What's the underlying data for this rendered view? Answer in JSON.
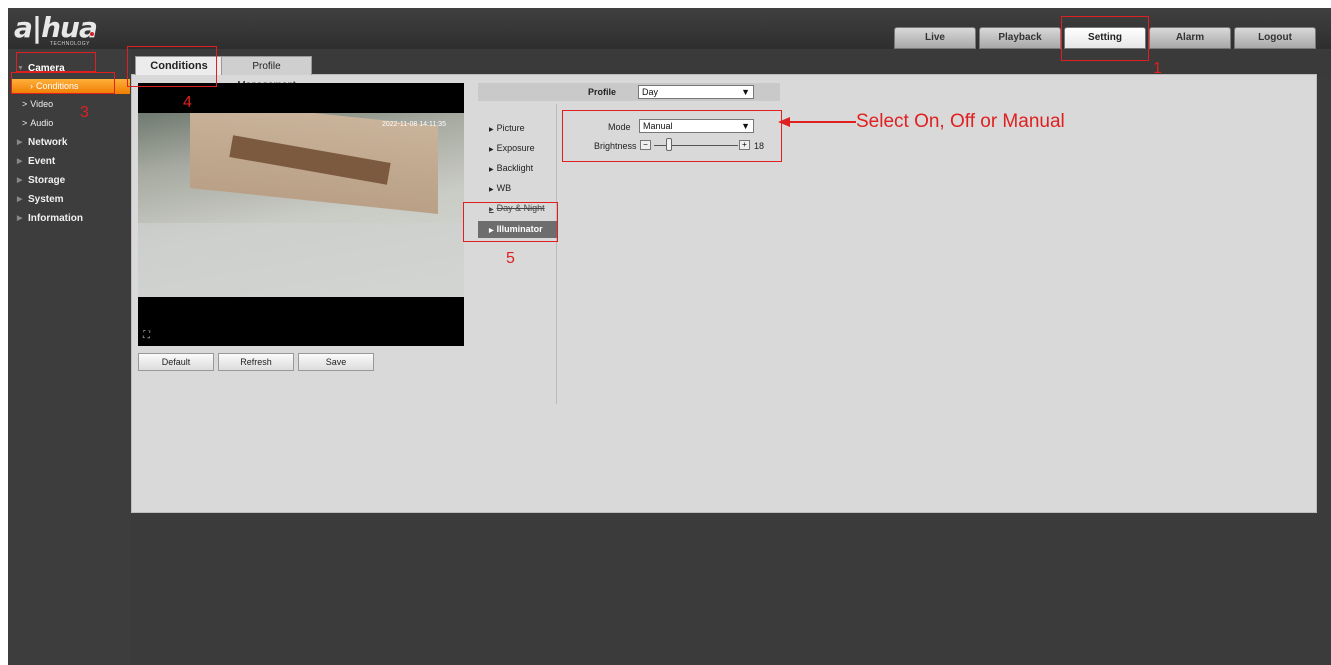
{
  "header": {
    "logo_text": "a|hua",
    "logo_sub": "TECHNOLOGY",
    "nav": [
      {
        "label": "Live",
        "active": false
      },
      {
        "label": "Playback",
        "active": false
      },
      {
        "label": "Setting",
        "active": true
      },
      {
        "label": "Alarm",
        "active": false
      },
      {
        "label": "Logout",
        "active": false
      }
    ]
  },
  "sidebar": {
    "camera": "Camera",
    "camera_sub": [
      {
        "label": "Conditions",
        "active": true
      },
      {
        "label": "Video",
        "active": false
      },
      {
        "label": "Audio",
        "active": false
      }
    ],
    "items": [
      "Network",
      "Event",
      "Storage",
      "System",
      "Information"
    ]
  },
  "tabs": [
    {
      "label": "Conditions",
      "active": true
    },
    {
      "label": "Profile Management",
      "active": false
    }
  ],
  "video": {
    "timestamp": "2022-11-08 14:11:35"
  },
  "buttons": {
    "default": "Default",
    "refresh": "Refresh",
    "save": "Save"
  },
  "profile": {
    "label": "Profile",
    "value": "Day"
  },
  "left_menu": [
    {
      "label": "Picture",
      "active": false
    },
    {
      "label": "Exposure",
      "active": false
    },
    {
      "label": "Backlight",
      "active": false
    },
    {
      "label": "WB",
      "active": false
    },
    {
      "label": "Day & Night",
      "active": false
    },
    {
      "label": "Illuminator",
      "active": true
    }
  ],
  "illuminator": {
    "mode_label": "Mode",
    "mode_value": "Manual",
    "brightness_label": "Brightness",
    "brightness_value": "18"
  },
  "annotations": {
    "num1": "1",
    "num3": "3",
    "num4": "4",
    "num5": "5",
    "callout": "Select On, Off or Manual"
  },
  "colors": {
    "annotation_red": "#e02020",
    "active_orange": "#f07d00"
  }
}
